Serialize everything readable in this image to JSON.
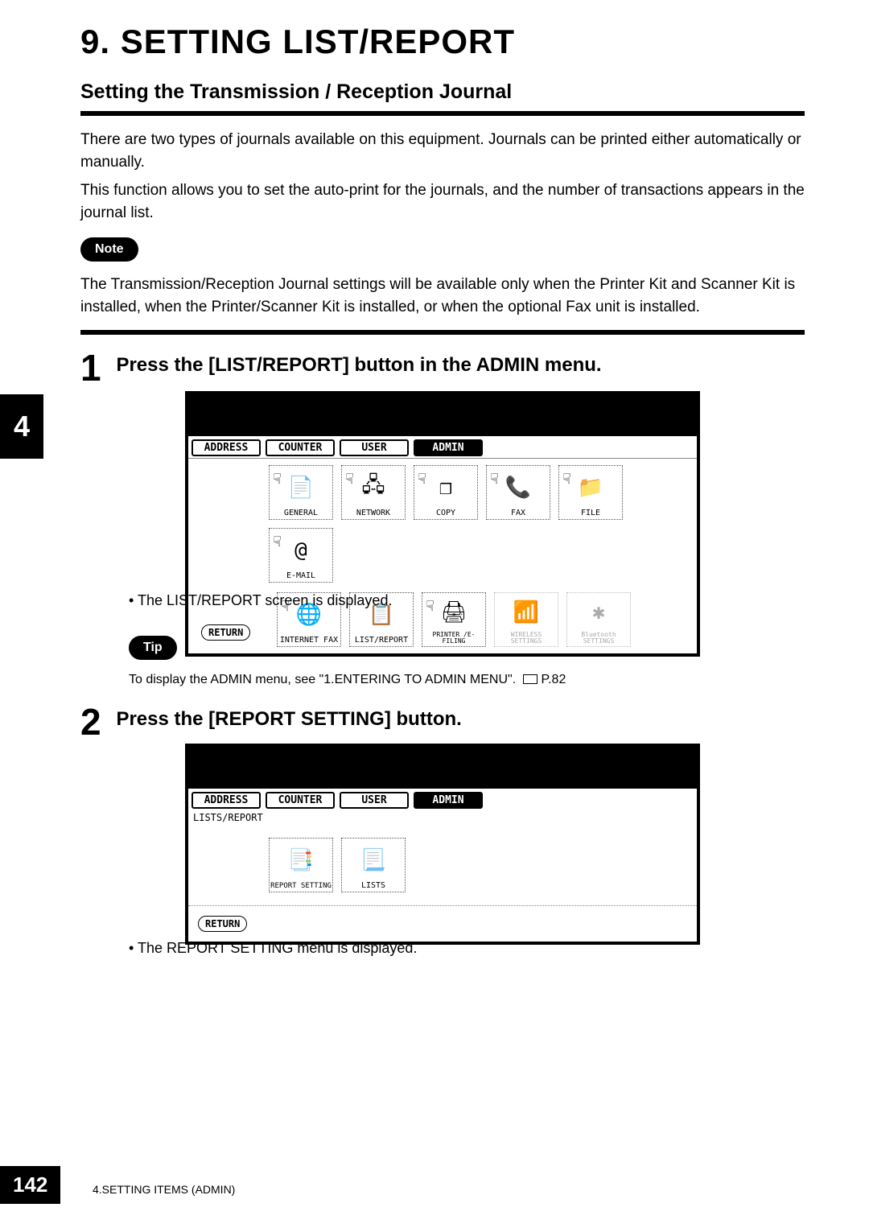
{
  "chapter": {
    "title": "9. SETTING LIST/REPORT"
  },
  "subheading": "Setting the Transmission / Reception Journal",
  "intro_p1": "There are two types of journals available on this equipment.  Journals can be printed either automatically or manually.",
  "intro_p2": "This function allows you to set the auto-print for the journals, and the number of transactions appears in the journal list.",
  "note": {
    "label": "Note",
    "text": "The Transmission/Reception Journal settings will be available only when the Printer Kit and Scanner Kit is installed, when the Printer/Scanner Kit is installed, or when the optional Fax unit is installed."
  },
  "side_tab": "4",
  "steps": [
    {
      "num": "1",
      "title": "Press the [LIST/REPORT] button in the ADMIN menu.",
      "screen": {
        "tabs": [
          "ADDRESS",
          "COUNTER",
          "USER",
          "ADMIN"
        ],
        "active_tab": "ADMIN",
        "icons_row1": [
          {
            "label": "GENERAL",
            "glyph": "📄"
          },
          {
            "label": "NETWORK",
            "glyph": "🖧"
          },
          {
            "label": "COPY",
            "glyph": "❐"
          },
          {
            "label": "FAX",
            "glyph": "📞"
          },
          {
            "label": "FILE",
            "glyph": "📁"
          },
          {
            "label": "E-MAIL",
            "glyph": "@"
          }
        ],
        "icons_row2": [
          {
            "label": "INTERNET FAX",
            "glyph": "🌐"
          },
          {
            "label": "LIST/REPORT",
            "glyph": "📋"
          },
          {
            "label": "PRINTER /E-FILING",
            "glyph": "🖨"
          },
          {
            "label": "WIRELESS SETTINGS",
            "glyph": "📶",
            "disabled": true
          },
          {
            "label": "Bluetooth SETTINGS",
            "glyph": "✱",
            "disabled": true
          }
        ],
        "return_label": "RETURN"
      },
      "after_bullet": "The LIST/REPORT screen is displayed.",
      "tip": {
        "label": "Tip",
        "text": "To display the ADMIN menu, see \"1.ENTERING TO ADMIN MENU\".",
        "ref": "P.82"
      }
    },
    {
      "num": "2",
      "title": "Press the [REPORT SETTING] button.",
      "screen": {
        "tabs": [
          "ADDRESS",
          "COUNTER",
          "USER",
          "ADMIN"
        ],
        "active_tab": "ADMIN",
        "crumb": "LISTS/REPORT",
        "icons_row1": [
          {
            "label": "REPORT SETTING",
            "glyph": "📑"
          },
          {
            "label": "LISTS",
            "glyph": "📃"
          }
        ],
        "return_label": "RETURN"
      },
      "after_bullet": "The REPORT SETTING menu is displayed."
    }
  ],
  "footer": {
    "page": "142",
    "section": "4.SETTING ITEMS (ADMIN)"
  }
}
